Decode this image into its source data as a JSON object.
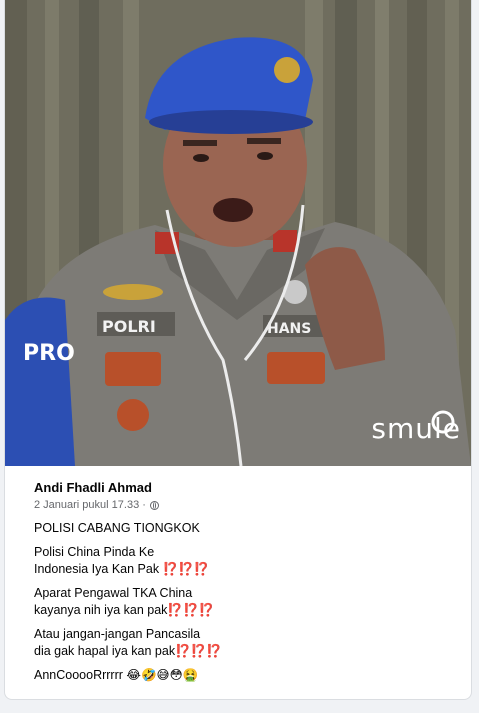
{
  "post": {
    "author": "Andi Fhadli Ahmad",
    "timestamp": "2 Januari pukul 17.33 ·",
    "paragraphs": [
      "POLISI CABANG TIONGKOK",
      "Polisi China Pinda Ke\nIndonesia Iya Kan Pak ⁉️⁉️⁉️",
      "Aparat Pengawal TKA China\nkayanya nih iya kan pak⁉️⁉️⁉️",
      "Atau jangan-jangan Pancasila\ndia gak hapal iya kan pak⁉️⁉️⁉️",
      "AnnCooooRrrrrr 😂🤣😅😳🤮"
    ]
  },
  "video": {
    "watermark": "smule",
    "beret_badge": "POLRI",
    "name_tag": "HANS",
    "shoulder_patch": "PRO"
  },
  "colors": {
    "background": "#f0f2f5",
    "card": "#ffffff",
    "meta_text": "#65676b",
    "beret": "#2f56c9"
  }
}
